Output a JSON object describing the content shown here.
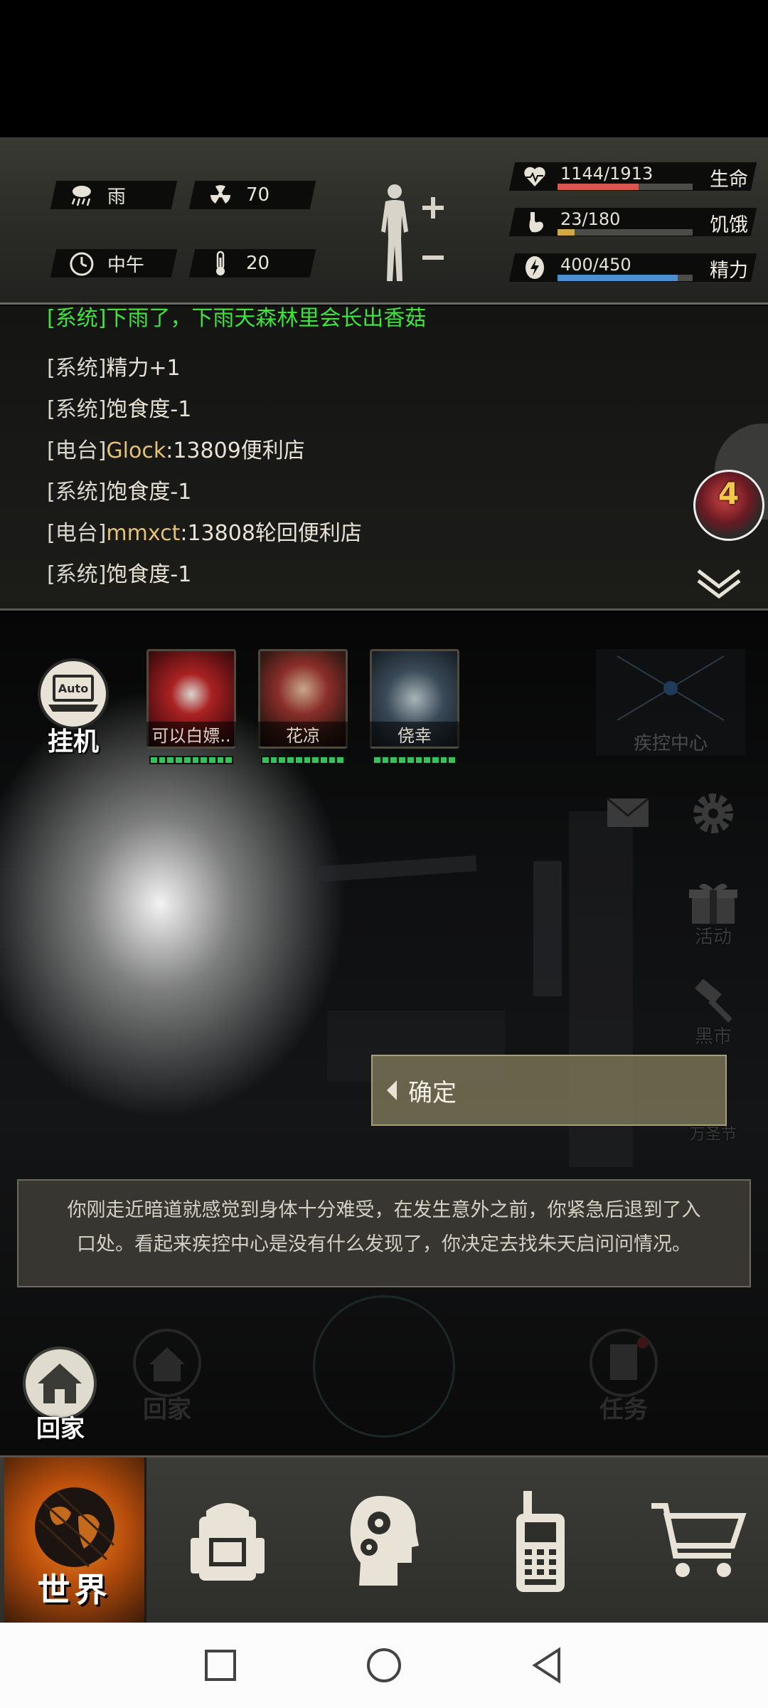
{
  "status": {
    "weather": "雨",
    "radiation": "70",
    "time_of_day": "中午",
    "temperature": "20",
    "stats": [
      {
        "key": "health",
        "value": "1144/1913",
        "label": "生命",
        "fraction": 0.598,
        "color": "#d9574a"
      },
      {
        "key": "hunger",
        "value": "23/180",
        "label": "饥饿",
        "fraction": 0.128,
        "color": "#d3a842"
      },
      {
        "key": "energy",
        "value": "400/450",
        "label": "精力",
        "fraction": 0.889,
        "color": "#4d8fd1"
      }
    ]
  },
  "log": {
    "lines": [
      {
        "tag": "[系统]",
        "player": "",
        "text": "下雨了，下雨天森林里会长出香菇",
        "green": true
      },
      {
        "tag": "[系统]",
        "player": "",
        "text": "精力+1",
        "green": false
      },
      {
        "tag": "[系统]",
        "player": "",
        "text": "饱食度-1",
        "green": false
      },
      {
        "tag": "[电台]",
        "player": "Glock",
        "text": ":13809便利店",
        "green": false
      },
      {
        "tag": "[系统]",
        "player": "",
        "text": "饱食度-1",
        "green": false
      },
      {
        "tag": "[电台]",
        "player": "mmxct",
        "text": ":13808轮回便利店",
        "green": false
      },
      {
        "tag": "[系统]",
        "player": "",
        "text": "饱食度-1",
        "green": false
      }
    ]
  },
  "floating_badge": {
    "count": "4"
  },
  "auto_button": {
    "badge": "Auto",
    "label": "挂机"
  },
  "team": [
    {
      "name": "可以白嫖.."
    },
    {
      "name": "花凉"
    },
    {
      "name": "侥幸"
    }
  ],
  "location": {
    "name": "疾控中心"
  },
  "side_menu": {
    "event_label": "活动",
    "black_market_label": "黑市",
    "halloween_label": "万圣节"
  },
  "confirm_button": {
    "label": "确定"
  },
  "narration": {
    "text": "你刚走近暗道就感觉到身体十分难受，在发生意外之前，你紧急后退到了入口处。看起来疾控中心是没有什么发现了，你决定去找朱天启问问情况。"
  },
  "bottom_actions": {
    "home_label": "回家",
    "ghost_home_label": "回家",
    "task_label": "任务"
  },
  "nav": {
    "world_label": "世界",
    "tabs": [
      "world-tab",
      "backpack-tab",
      "skills-tab",
      "radio-tab",
      "shop-tab"
    ]
  }
}
